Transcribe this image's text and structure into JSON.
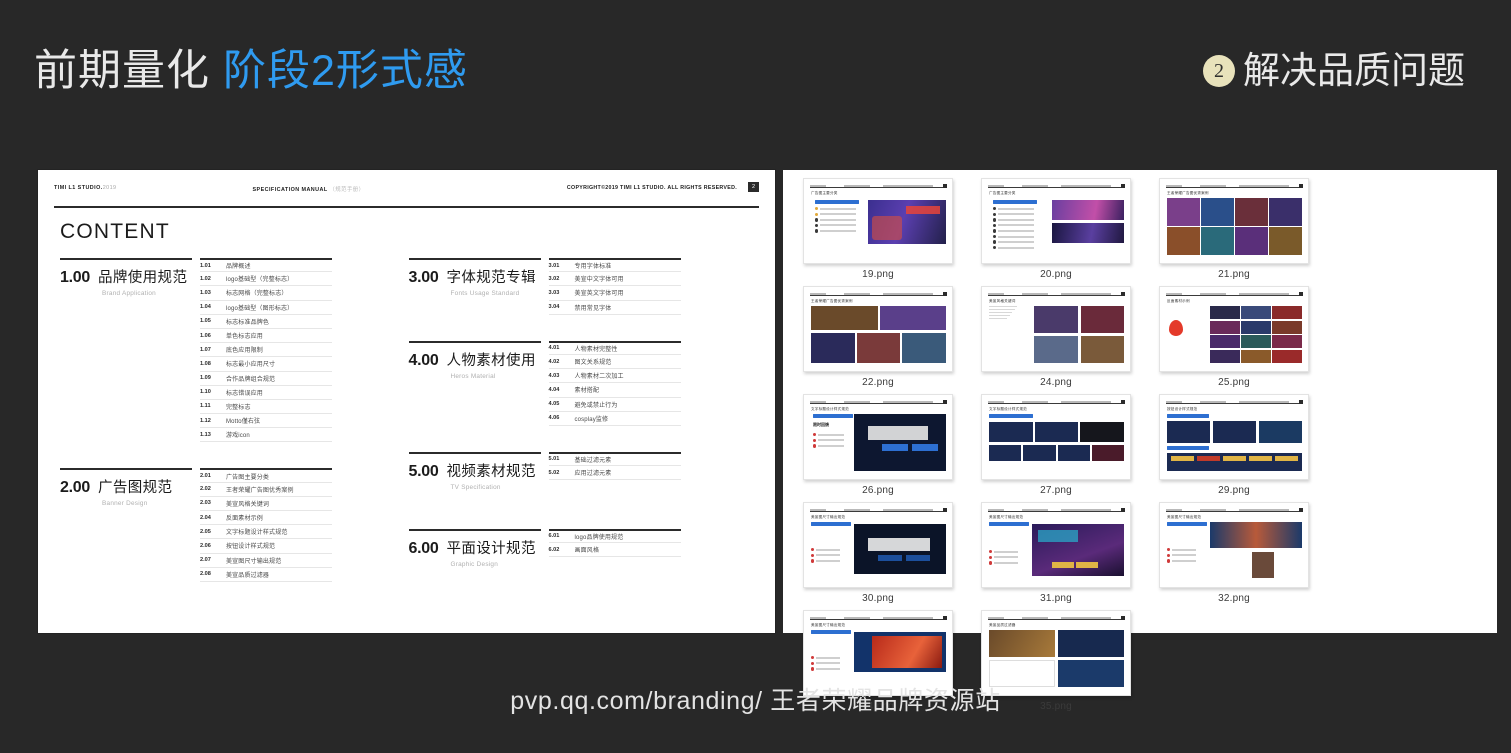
{
  "header": {
    "title_plain": "前期量化",
    "title_accent": "阶段2形式感",
    "badge": "2",
    "title_right": "解决品质问题",
    "accent_color": "#2f9bf0",
    "badge_color": "#e8e2bb",
    "background_color": "#282828"
  },
  "document": {
    "topbar": {
      "studio": "TIMI L1 STUDIO.",
      "studio_year": "2019",
      "spec": "SPECIFICATION MANUAL",
      "spec_cn": "（规范手册）",
      "copyright": "COPYRIGHT©2019 TIMI L1 STUDIO. ALL RIGHTS RESERVED.",
      "page": "2"
    },
    "heading": "CONTENT",
    "groups": [
      {
        "num": "1.00",
        "title_cn": "品牌使用规范",
        "title_en": "Brand Application",
        "items": [
          {
            "no": "1.01",
            "text": "品牌概述"
          },
          {
            "no": "1.02",
            "text": "logo基础型（完整标志）"
          },
          {
            "no": "1.03",
            "text": "标志网格（完整标志）"
          },
          {
            "no": "1.04",
            "text": "logo基础型（图形标志）"
          },
          {
            "no": "1.05",
            "text": "标志标准品牌色"
          },
          {
            "no": "1.06",
            "text": "单色标志应用"
          },
          {
            "no": "1.07",
            "text": "底色应用限制"
          },
          {
            "no": "1.08",
            "text": "标志最小应用尺寸"
          },
          {
            "no": "1.09",
            "text": "合作品牌组合规范"
          },
          {
            "no": "1.10",
            "text": "标志错误应用"
          },
          {
            "no": "1.11",
            "text": "完整标志"
          },
          {
            "no": "1.12",
            "text": "Motto僅右弦"
          },
          {
            "no": "1.13",
            "text": "游戏icon"
          }
        ]
      },
      {
        "num": "2.00",
        "title_cn": "广告图规范",
        "title_en": "Banner Design",
        "items": [
          {
            "no": "2.01",
            "text": "广告图主要分类"
          },
          {
            "no": "2.02",
            "text": "王者荣耀广告图优秀案例"
          },
          {
            "no": "2.03",
            "text": "美宣风格关键词"
          },
          {
            "no": "2.04",
            "text": "反面素材示例"
          },
          {
            "no": "2.05",
            "text": "文字标题设计样式规范"
          },
          {
            "no": "2.06",
            "text": "按钮设计样式规范"
          },
          {
            "no": "2.07",
            "text": "美宣图尺寸输出规范"
          },
          {
            "no": "2.08",
            "text": "美宣品质过滤器"
          }
        ]
      },
      {
        "num": "3.00",
        "title_cn": "字体规范专辑",
        "title_en": "Fonts Usage Standard",
        "items": [
          {
            "no": "3.01",
            "text": "专用字体标准"
          },
          {
            "no": "3.02",
            "text": "美宣中文字体可用"
          },
          {
            "no": "3.03",
            "text": "美宣英文字体可用"
          },
          {
            "no": "3.04",
            "text": "禁用常见字体"
          }
        ]
      },
      {
        "num": "4.00",
        "title_cn": "人物素材使用",
        "title_en": "Heros Material",
        "items": [
          {
            "no": "4.01",
            "text": "人物素材完整性"
          },
          {
            "no": "4.02",
            "text": "图文关系规范"
          },
          {
            "no": "4.03",
            "text": "人物素材二次加工"
          },
          {
            "no": "4.04",
            "text": "素材搭配"
          },
          {
            "no": "4.05",
            "text": "避免或禁止行为"
          },
          {
            "no": "4.06",
            "text": "cosplay监修"
          }
        ]
      },
      {
        "num": "5.00",
        "title_cn": "视频素材规范",
        "title_en": "TV Specification",
        "items": [
          {
            "no": "5.01",
            "text": "基础过滤元素"
          },
          {
            "no": "5.02",
            "text": "应用过滤元素"
          }
        ]
      },
      {
        "num": "6.00",
        "title_cn": "平面设计规范",
        "title_en": "Graphic Design",
        "items": [
          {
            "no": "6.01",
            "text": "logo品牌使用规范"
          },
          {
            "no": "6.02",
            "text": "画面风格"
          }
        ]
      }
    ]
  },
  "thumbnails": [
    {
      "label": "19.png",
      "slide_title": "广告图主要分类",
      "style": "list-banner"
    },
    {
      "label": "20.png",
      "slide_title": "广告图主要分类",
      "style": "list-two-banner"
    },
    {
      "label": "21.png",
      "slide_title": "王者荣耀广告图优秀案例",
      "style": "gallery-grid"
    },
    {
      "label": "22.png",
      "slide_title": "王者荣耀广告图优秀案例",
      "style": "gallery-wide"
    },
    {
      "label": "24.png",
      "slide_title": "美宣风格关键词",
      "style": "four-cards"
    },
    {
      "label": "25.png",
      "slide_title": "反面素材示例",
      "style": "mosaic"
    },
    {
      "label": "26.png",
      "slide_title": "文字标题设计样式规范",
      "style": "dark-banner"
    },
    {
      "label": "27.png",
      "slide_title": "文字标题设计样式规范",
      "style": "title-tiles"
    },
    {
      "label": "29.png",
      "slide_title": "按钮设计样式规范",
      "style": "buttons"
    },
    {
      "label": "30.png",
      "slide_title": "美宣图尺寸输出规范",
      "style": "spec-banner"
    },
    {
      "label": "31.png",
      "slide_title": "美宣图尺寸输出规范",
      "style": "spec-banner-alt"
    },
    {
      "label": "32.png",
      "slide_title": "美宣图尺寸输出规范",
      "style": "spec-portrait"
    },
    {
      "label": "34.png",
      "slide_title": "美宣图尺寸输出规范",
      "style": "spec-red"
    },
    {
      "label": "35.png",
      "slide_title": "美宣品质过滤器",
      "style": "filter-grid"
    }
  ],
  "footer": {
    "text": "pvp.qq.com/branding/ 王者荣耀品牌资源站"
  }
}
